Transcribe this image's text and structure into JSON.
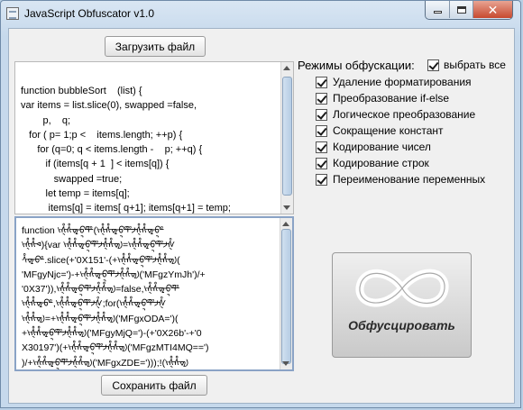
{
  "window": {
    "title": "JavaScript Obfuscator v1.0"
  },
  "buttons": {
    "load": "Загрузить файл",
    "save": "Сохранить файл",
    "obfuscate": "Обфусцировать"
  },
  "source_code": [
    "function bubbleSort    (list) {",
    "var items = list.slice(0), swapped =false,",
    "        p,    q;",
    "   for ( p= 1;p <    items.length; ++p) {",
    "      for (q=0; q < items.length -    p; ++q) {",
    "         if (items[q + 1  ] < items[q]) {",
    "            swapped =true;",
    "         let temp = items[q];",
    "          items[q] = items[ q+1]; items[q+1] = temp;"
  ],
  "obfuscated_code": [
    "function ᢣᢤᢥᢦᢧᢨᢩᢪ(ᢣᢤᢥᢦᢧᢨᢩᢪᢣᢤᢥᢦᢧᢨᢩ",
    "ᢣᢤᢥᢦ){var ᢣᢤᢥᢦᢧᢨᢩᢪᢣᢤᢥᢦᢧ=ᢣᢤᢥᢦᢧᢨᢩᢪᢣᢤ",
    "ᢥᢦᢧᢨ.slice(+'0X151'-(+ᢣᢤᢥᢦᢧᢨᢩᢪᢣᢤᢥᢦᢧ(",
    "'MFgyNjc=')-+ᢣᢤᢥᢦᢧᢨᢩᢪᢣᢤᢥᢦᢧ('MFgzYmJh')/+",
    "'0X37')),ᢣᢤᢥᢦᢧᢨᢩᢪᢣᢤᢥᢦᢧ=false,ᢣᢤᢥᢦᢧᢨᢩᢪ",
    "ᢣᢤᢥᢦᢧᢨ,ᢣᢤᢥᢦᢧᢨᢩᢪᢣᢤ;for(ᢣᢤᢥᢦᢧᢨᢩᢪᢣᢤ",
    "ᢣᢤᢥᢦᢧ=+ᢣᢤᢥᢦᢧᢨᢩᢪᢣᢤᢥᢦᢧ('MFgxODA=')(",
    "+ᢣᢤᢥᢦᢧᢨᢩᢪᢣᢤᢥᢦᢧ('MFgyMjQ=')-(+'0X26b'-+'0",
    "X30197')(+ᢣᢤᢥᢦᢧᢨᢩᢪᢣᢤᢥᢦᢧ('MFgzMTI4MQ==')",
    ")/+ᢣᢤᢥᢦᢧᢨᢩᢪᢣᢤᢥᢦᢧ('MFgxZDE=')));!(ᢣᢤᢥᢦᢧ"
  ],
  "modes": {
    "title": "Режимы обфускации:",
    "select_all": {
      "label": "выбрать все",
      "checked": true
    },
    "options": [
      {
        "label": "Удаление форматирования",
        "checked": true
      },
      {
        "label": "Преобразование if-else",
        "checked": true
      },
      {
        "label": "Логическое преобразование",
        "checked": true
      },
      {
        "label": "Сокращение констант",
        "checked": true
      },
      {
        "label": "Кодирование чисел",
        "checked": true
      },
      {
        "label": "Кодирование строк",
        "checked": true
      },
      {
        "label": "Переименование переменных",
        "checked": true
      }
    ]
  },
  "icons": {
    "app": "app-window-icon",
    "obfuscate": "knot-icon"
  }
}
